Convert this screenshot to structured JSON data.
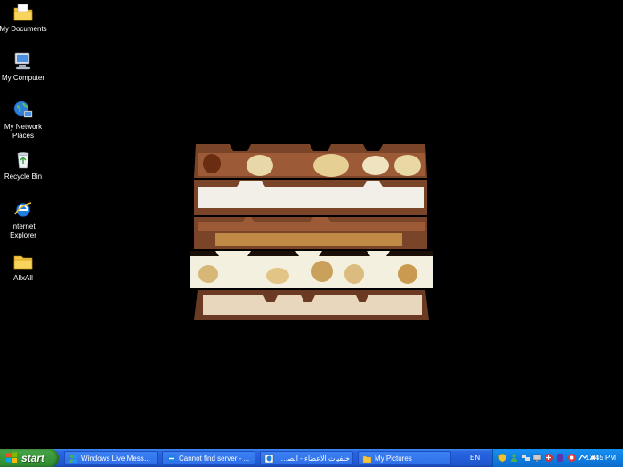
{
  "desktop": {
    "icons": [
      {
        "label": "My Documents"
      },
      {
        "label": "My Computer"
      },
      {
        "label": "My Network Places"
      },
      {
        "label": "Recycle Bin"
      },
      {
        "label": "Internet Explorer"
      },
      {
        "label": "AllxAll"
      }
    ]
  },
  "taskbar": {
    "start_label": "start",
    "tasks": [
      {
        "label": "Windows Live Messen...",
        "icon": "messenger-icon"
      },
      {
        "label": "Cannot find server - ...",
        "icon": "ie-icon"
      },
      {
        "label": "خلفيات الاعضاء - الصف...",
        "icon": "ie-icon"
      },
      {
        "label": "My Pictures",
        "icon": "folder-icon"
      }
    ],
    "language": "EN",
    "clock": "12:45 PM"
  },
  "colors": {
    "desktop_bg": "#000000",
    "taskbar_blue": "#245edb",
    "start_green": "#3c9a3c",
    "tray_blue": "#0f7ee2"
  }
}
